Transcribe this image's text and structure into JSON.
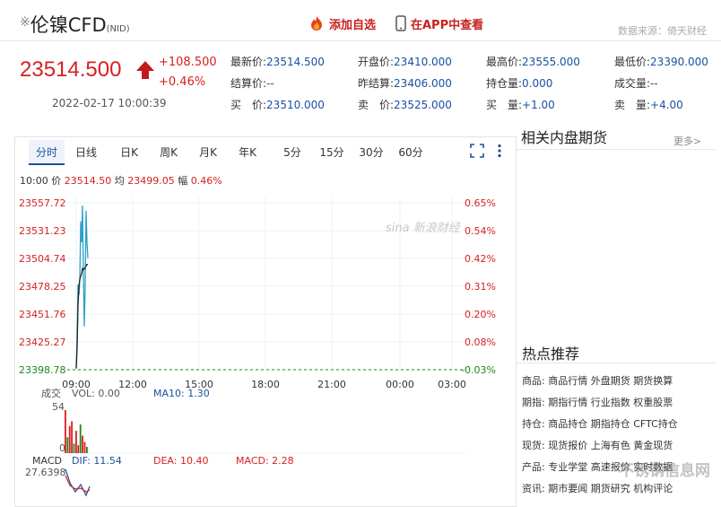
{
  "header": {
    "title": "伦镍CFD",
    "subtitle": "(NID)",
    "add_fav": "添加自选",
    "app_view": "在APP中查看",
    "source": "数据来源：倚天财经"
  },
  "quote": {
    "price": "23514.500",
    "change": "+108.500",
    "change_pct": "+0.46%",
    "time": "2022-02-17 10:00:39",
    "fields": [
      {
        "label": "最新价:",
        "value": "23514.500"
      },
      {
        "label": "开盘价:",
        "value": "23410.000"
      },
      {
        "label": "最高价:",
        "value": "23555.000"
      },
      {
        "label": "最低价:",
        "value": "23390.000"
      },
      {
        "label": "结算价:",
        "value": "--"
      },
      {
        "label": "昨结算:",
        "value": "23406.000"
      },
      {
        "label": "持仓量:",
        "value": "0.000"
      },
      {
        "label": "成交量:",
        "value": "--"
      },
      {
        "label": "买　价:",
        "value": "23510.000"
      },
      {
        "label": "卖　价:",
        "value": "23525.000"
      },
      {
        "label": "买　量:",
        "value": "+1.00"
      },
      {
        "label": "卖　量:",
        "value": "+4.00"
      }
    ]
  },
  "tabs": [
    "分时",
    "日线",
    "日K",
    "周K",
    "月K",
    "年K",
    "5分",
    "15分",
    "30分",
    "60分"
  ],
  "info_line": {
    "time": "10:00",
    "price_label": "价",
    "price": "23514.50",
    "avg_label": "均",
    "avg": "23499.05",
    "amp_label": "幅",
    "amp": "0.46%"
  },
  "chart_data": {
    "type": "line",
    "y_ticks": [
      "23557.72",
      "23531.23",
      "23504.74",
      "23478.25",
      "23451.76",
      "23425.27",
      "23398.78"
    ],
    "pct_ticks": [
      "0.65%",
      "0.54%",
      "0.42%",
      "0.31%",
      "0.20%",
      "0.08%",
      "-0.03%"
    ],
    "x_ticks": [
      "09:00",
      "12:00",
      "15:00",
      "18:00",
      "21:00",
      "00:00",
      "03:00"
    ],
    "series": [
      {
        "values": [
          23400,
          23430,
          23480,
          23470,
          23485,
          23540,
          23520,
          23555,
          23490,
          23440,
          23480,
          23550,
          23520,
          23505
        ]
      },
      {
        "values": [
          23400,
          23420,
          23460,
          23478,
          23485,
          23488,
          23490,
          23495,
          23494,
          23495,
          23496,
          23498,
          23499,
          23499
        ]
      }
    ],
    "ylim": [
      23398.78,
      23557.72
    ],
    "volume": {
      "label": "成交",
      "vol_label": "VOL: 0.00",
      "ma_label": "MA10: 1.30",
      "max": "54",
      "min": "0",
      "values": [
        54,
        20,
        34,
        40,
        12,
        28,
        10,
        36,
        22,
        14,
        8
      ]
    },
    "macd": {
      "label": "MACD",
      "dif": "DIF: 11.54",
      "dea": "DEA: 10.40",
      "macd": "MACD: 2.28",
      "max": "27.6398"
    }
  },
  "side": {
    "related_title": "相关内盘期货",
    "more": "更多>",
    "hot_title": "热点推荐",
    "hot_rows": [
      {
        "key": "商品:",
        "links": [
          "商品行情",
          "外盘期货",
          "期货换算"
        ]
      },
      {
        "key": "期指:",
        "links": [
          "期指行情",
          "行业指数",
          "权重股票"
        ]
      },
      {
        "key": "持仓:",
        "links": [
          "商品持仓",
          "期指持仓",
          "CFTC持仓"
        ]
      },
      {
        "key": "现货:",
        "links": [
          "现货报价",
          "上海有色",
          "黄金现货"
        ]
      },
      {
        "key": "产品:",
        "links": [
          "专业学堂",
          "高速报价",
          "实时数据"
        ]
      },
      {
        "key": "资讯:",
        "links": [
          "期市要闻",
          "期货研究",
          "机构评论"
        ]
      }
    ]
  },
  "watermark": "不锈钢信息网"
}
